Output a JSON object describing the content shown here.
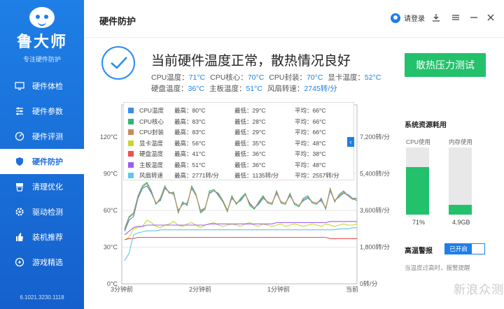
{
  "app": {
    "name": "鲁大师",
    "subtitle": "专注硬件防护",
    "version": "6.1021.3230.1118"
  },
  "sidebar": {
    "items": [
      {
        "label": "硬件体检",
        "icon": "monitor-icon"
      },
      {
        "label": "硬件参数",
        "icon": "sliders-icon"
      },
      {
        "label": "硬件评测",
        "icon": "gauge-icon"
      },
      {
        "label": "硬件防护",
        "icon": "shield-icon",
        "active": true
      },
      {
        "label": "清理优化",
        "icon": "broom-icon"
      },
      {
        "label": "驱动检测",
        "icon": "gear-icon"
      },
      {
        "label": "装机推荐",
        "icon": "thumbs-up-icon"
      },
      {
        "label": "游戏精选",
        "icon": "gamepad-icon"
      }
    ]
  },
  "header": {
    "title": "硬件防护",
    "login_label": "请登录"
  },
  "status": {
    "title": "当前硬件温度正常，散热情况良好",
    "readings": [
      {
        "label": "CPU温度：",
        "value": "71°C"
      },
      {
        "label": "CPU核心：",
        "value": "70°C"
      },
      {
        "label": "CPU封装：",
        "value": "70°C"
      },
      {
        "label": "显卡温度：",
        "value": "52°C"
      },
      {
        "label": "硬盘温度：",
        "value": "36°C"
      },
      {
        "label": "主板温度：",
        "value": "51°C"
      },
      {
        "label": "风扇转速：",
        "value": "2745转/分"
      }
    ]
  },
  "stress_button": "散热压力测试",
  "legend": [
    {
      "name": "CPU温度",
      "color": "#3a8ee6",
      "max": "最高：80°C",
      "min": "最低：29°C",
      "avg": "平均：66°C"
    },
    {
      "name": "CPU核心",
      "color": "#2fb774",
      "max": "最高：83°C",
      "min": "最低：28°C",
      "avg": "平均：66°C"
    },
    {
      "name": "CPU封装",
      "color": "#c98a5c",
      "max": "最高：83°C",
      "min": "最低：29°C",
      "avg": "平均：66°C"
    },
    {
      "name": "显卡温度",
      "color": "#c8d62a",
      "max": "最高：56°C",
      "min": "最低：35°C",
      "avg": "平均：48°C"
    },
    {
      "name": "硬盘温度",
      "color": "#ee4f4f",
      "max": "最高：41°C",
      "min": "最低：36°C",
      "avg": "平均：38°C"
    },
    {
      "name": "主板温度",
      "color": "#9b5cf0",
      "max": "最高：51°C",
      "min": "最低：36°C",
      "avg": "平均：48°C"
    },
    {
      "name": "风扇转速",
      "color": "#5ec6e8",
      "max": "最高：2771转/分",
      "min": "最低：1135转/分",
      "avg": "平均：2557转/分"
    }
  ],
  "chart_data": {
    "type": "line",
    "y_left_ticks": [
      "120°C",
      "90°C",
      "60°C",
      "30°C",
      "0°C"
    ],
    "y_right_ticks": [
      "7,200转/分",
      "5,400转/分",
      "3,600转/分",
      "1,800转/分",
      "0转/分"
    ],
    "x_ticks": [
      "3分钟前",
      "2分钟前",
      "1分钟前",
      "当前"
    ],
    "ylim_left": [
      0,
      120
    ],
    "ylim_right": [
      0,
      7200
    ],
    "series": [
      {
        "name": "CPU温度",
        "values": [
          43,
          52,
          55,
          70,
          78,
          80,
          74,
          66,
          68,
          78,
          75,
          73,
          60,
          65,
          66,
          78,
          72,
          60,
          62,
          74,
          76,
          74,
          68,
          60,
          70,
          66,
          68,
          73,
          66,
          62,
          65,
          70,
          67,
          66,
          74,
          67,
          66,
          72,
          66,
          64,
          68,
          70,
          67,
          66,
          68,
          62,
          76,
          68,
          71,
          74,
          73,
          70,
          68
        ]
      },
      {
        "name": "CPU核心",
        "values": [
          45,
          55,
          58,
          72,
          80,
          83,
          76,
          65,
          70,
          80,
          74,
          75,
          58,
          67,
          64,
          80,
          73,
          58,
          61,
          76,
          77,
          72,
          67,
          59,
          72,
          65,
          70,
          74,
          64,
          61,
          67,
          72,
          66,
          65,
          76,
          66,
          65,
          74,
          65,
          63,
          70,
          72,
          66,
          65,
          70,
          61,
          78,
          67,
          73,
          76,
          72,
          69,
          70
        ]
      },
      {
        "name": "CPU封装",
        "values": [
          44,
          54,
          57,
          71,
          79,
          82,
          75,
          66,
          69,
          79,
          75,
          74,
          59,
          66,
          65,
          79,
          72,
          59,
          62,
          75,
          76,
          73,
          68,
          60,
          71,
          66,
          69,
          73,
          65,
          62,
          66,
          71,
          67,
          66,
          75,
          67,
          66,
          73,
          66,
          64,
          69,
          71,
          67,
          66,
          69,
          62,
          77,
          68,
          72,
          75,
          72,
          70,
          70
        ]
      },
      {
        "name": "显卡温度",
        "values": [
          36,
          38,
          45,
          46,
          47,
          52,
          50,
          47,
          46,
          48,
          49,
          51,
          48,
          47,
          49,
          50,
          48,
          46,
          48,
          49,
          50,
          48,
          47,
          48,
          49,
          48,
          47,
          49,
          50,
          48,
          47,
          49,
          48,
          47,
          48,
          49,
          47,
          48,
          49,
          48,
          47,
          48,
          49,
          48,
          47,
          49,
          48,
          47,
          48,
          49,
          48,
          48,
          49
        ]
      },
      {
        "name": "硬盘温度",
        "values": [
          36,
          37,
          37,
          38,
          38,
          38,
          38,
          38,
          38,
          38,
          38,
          38,
          38,
          38,
          38,
          38,
          38,
          38,
          38,
          38,
          38,
          38,
          38,
          38,
          38,
          38,
          38,
          38,
          38,
          38,
          38,
          38,
          38,
          38,
          38,
          38,
          38,
          38,
          38,
          38,
          38,
          38,
          38,
          38,
          38,
          38,
          37,
          37,
          37,
          37,
          37,
          37,
          37
        ]
      },
      {
        "name": "主板温度",
        "values": [
          40,
          43,
          46,
          47,
          47,
          48,
          48,
          48,
          48,
          48,
          48,
          48,
          48,
          48,
          48,
          48,
          48,
          48,
          48,
          49,
          49,
          49,
          49,
          49,
          49,
          49,
          49,
          49,
          49,
          49,
          49,
          49,
          49,
          49,
          50,
          50,
          50,
          50,
          50,
          50,
          50,
          50,
          50,
          50,
          50,
          50,
          51,
          51,
          51,
          51,
          51,
          51,
          51
        ]
      },
      {
        "name": "风扇转速",
        "values": [
          1135,
          1500,
          2400,
          2500,
          2550,
          2600,
          2600,
          2600,
          2650,
          2650,
          2650,
          2650,
          2650,
          2650,
          2650,
          2650,
          2650,
          2650,
          2650,
          2650,
          2650,
          2650,
          2650,
          2650,
          2650,
          2650,
          2650,
          2650,
          2650,
          2650,
          2650,
          2650,
          2650,
          2650,
          2650,
          2650,
          2650,
          2650,
          2650,
          2650,
          2650,
          2650,
          2650,
          2650,
          2650,
          2650,
          2650,
          2650,
          2700,
          2700,
          2700,
          2750,
          2745
        ]
      }
    ]
  },
  "resources": {
    "title": "系统资源耗用",
    "cpu_label": "CPU使用",
    "cpu_value": "71%",
    "cpu_fraction": 0.71,
    "mem_label": "内存使用",
    "mem_value": "4.9GB",
    "mem_fraction": 0.15
  },
  "alert": {
    "title": "高温警报",
    "toggle_label": "已开启",
    "desc": "当温度过高时，报警提醒"
  },
  "watermark": "新浪众测"
}
